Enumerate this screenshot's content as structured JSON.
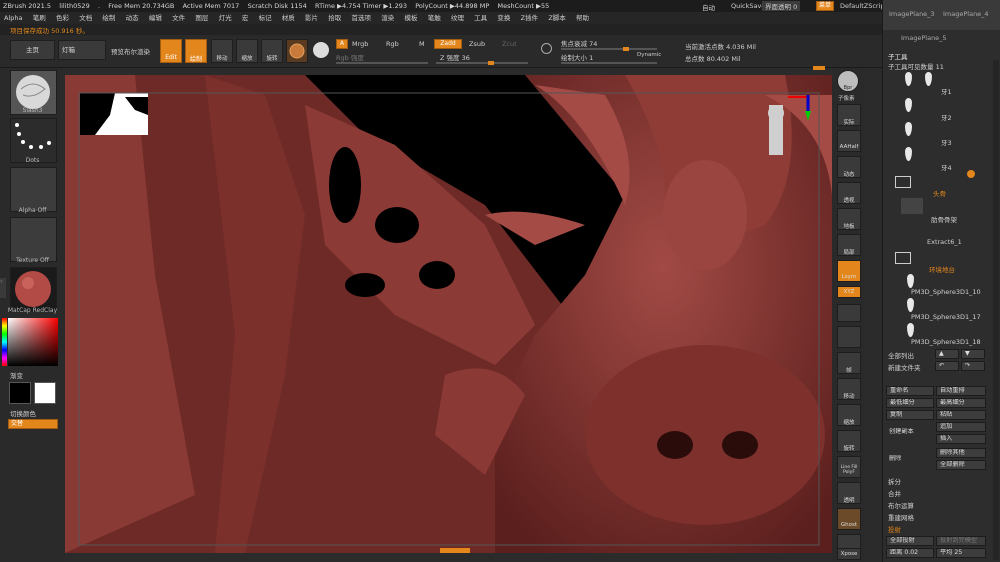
{
  "titlebar": {
    "items": [
      "ZBrush 2021.5",
      "lilith0529",
      ".",
      "Free Mem 20.734GB",
      "Active Mem 7017",
      "Scratch Disk 1154",
      "RTime ▶4.754 Timer ▶1.293",
      "PolyCount ▶44.898 MP",
      "MeshCount ▶55"
    ],
    "right": {
      "menu": "自动",
      "quicksave": "QuickSave",
      "transparency": "界面透明 0",
      "menus_btn": "菜单",
      "script": "DefaultZScript"
    }
  },
  "menubar": [
    "Alpha",
    "笔刷",
    "色彩",
    "文档",
    "绘制",
    "动态",
    "编辑",
    "文件",
    "图层",
    "灯光",
    "宏",
    "标记",
    "材质",
    "影片",
    "拾取",
    "首选项",
    "渲染",
    "模板",
    "笔触",
    "纹理",
    "工具",
    "变换",
    "Z插件",
    "Z脚本",
    "帮助"
  ],
  "status": "项目保存成功 50.916 秒。",
  "toolbar": {
    "home": "主页",
    "lightbox": "灯箱",
    "preview": "预览布尔渲染",
    "edit": "Edit",
    "draw": "绘制",
    "move": "移动",
    "scale": "缩放",
    "rotate": "旋转",
    "a": "A",
    "mrgb": "Mrgb",
    "rgb": "Rgb",
    "m": "M",
    "zadd": "Zadd",
    "zsub": "Zsub",
    "zcut": "Zcut",
    "rgb_int": "Rgb 强度",
    "z_int": "Z 强度 36",
    "focal": "焦点衰减 74",
    "draw_size": "绘制大小 1",
    "dynamic": "Dynamic",
    "active_pts": "当前激活点数 4.036 Mil",
    "total_pts": "总点数 80.402 Mil"
  },
  "left": {
    "brush": "Slash3",
    "stroke": "Dots",
    "alpha": "Alpha Off",
    "texture": "Texture Off",
    "material": "MatCap RedClay",
    "gradient": "渐变",
    "switch": "切换颜色",
    "alt": "交替"
  },
  "rightbar": [
    "Bpr",
    "子像素",
    "实际",
    "AAHalf",
    "动态",
    "透视",
    "地板",
    "局部",
    "Lsym",
    "XYZ",
    "",
    "",
    "帧",
    "移动",
    "缩放",
    "旋转",
    "Line Fill PolyF",
    "透明",
    "Ghost",
    "独立",
    "",
    "Xpose"
  ],
  "subtool": {
    "header_img1": "ImagePlane_3",
    "header_img2": "ImagePlane_4",
    "imgplane": "ImagePlane_5",
    "title": "子工具",
    "visible_count": "子工具可见数量 11",
    "items": [
      "牙1",
      "牙2",
      "牙3",
      "牙4"
    ],
    "folder1": "头骨",
    "folder1_sub": "肋骨骨架",
    "extract": "Extract6_1",
    "folder2": "环境地台",
    "spheres": [
      "PM3D_Sphere3D1_10",
      "PM3D_Sphere3D1_17",
      "PM3D_Sphere3D1_18"
    ],
    "list_all": "全部列出",
    "new_folder": "新建文件夹",
    "rename": "重命名",
    "autoreorder": "自动重排",
    "lowest": "最低细分",
    "highest": "最高细分",
    "copy": "复制",
    "paste": "粘贴",
    "append": "追加",
    "insert": "插入",
    "dup": "创建副本",
    "del": "删除",
    "del_other": "删除其他",
    "del_all": "全部删除",
    "split": "拆分",
    "merge": "合并",
    "boolean": "布尔运算",
    "remesh": "重建网格",
    "project": "投射",
    "project_all": "全部投射",
    "proj_shadow": "投射到完模型",
    "dist": "距离 0.02",
    "mean": "平均 25"
  }
}
